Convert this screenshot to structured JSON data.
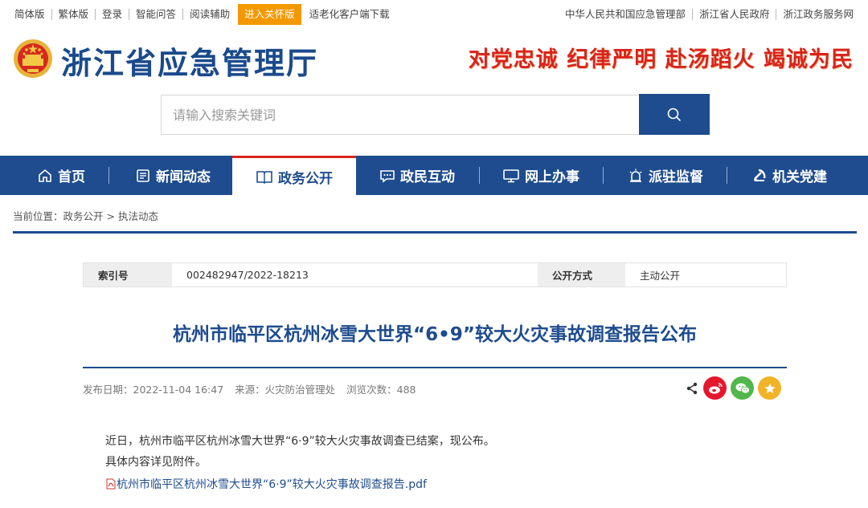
{
  "topbar": {
    "left_links": [
      "简体版",
      "繁体版",
      "登录",
      "智能问答",
      "阅读辅助",
      "进入关怀版",
      "适老化客户端下载"
    ],
    "right_links": [
      "中华人民共和国应急管理部",
      "浙江省人民政府",
      "浙江政务服务网"
    ]
  },
  "header": {
    "site_title": "浙江省应急管理厅",
    "slogan": "对党忠诚 纪律严明 赴汤蹈火 竭诚为民",
    "emblem_icon": "national-emblem-icon"
  },
  "search": {
    "placeholder": "请输入搜索关键词",
    "button_icon": "search-icon"
  },
  "nav": {
    "items": [
      {
        "label": "首页",
        "icon": "home-icon"
      },
      {
        "label": "新闻动态",
        "icon": "newspaper-icon"
      },
      {
        "label": "政务公开",
        "icon": "book-icon"
      },
      {
        "label": "政民互动",
        "icon": "chat-icon"
      },
      {
        "label": "网上办事",
        "icon": "monitor-icon"
      },
      {
        "label": "派驻监督",
        "icon": "alarm-icon"
      },
      {
        "label": "机关党建",
        "icon": "party-icon"
      }
    ],
    "active_index": 2
  },
  "breadcrumb": {
    "prefix": "当前位置：",
    "items": [
      "政务公开",
      "执法动态"
    ],
    "separator": ">"
  },
  "meta": {
    "index_label": "索引号",
    "index_value": "002482947/2022-18213",
    "open_label": "公开方式",
    "open_value": "主动公开"
  },
  "article": {
    "title": "杭州市临平区杭州冰雪大世界“6•9”较大火灾事故调查报告公布",
    "publish_date": "发布日期：2022-11-04 16:47",
    "source": "来源：火灾防治管理处",
    "views": "浏览次数：488",
    "paragraphs": [
      "近日，杭州市临平区杭州冰雪大世界“6·9”较大火灾事故调查已结案，现公布。",
      "具体内容详见附件。"
    ],
    "attachment": "杭州市临平区杭州冰雪大世界“6·9”较大火灾事故调查报告.pdf"
  },
  "share": {
    "icons": [
      "share-icon",
      "weibo-icon",
      "wechat-icon",
      "favorite-icon"
    ]
  },
  "colors": {
    "primary": "#1e4c8e",
    "accent_red": "#d8241b",
    "care_orange": "#f39800",
    "weibo": "#e6162d",
    "wechat": "#51b74a",
    "favorite": "#f3b326"
  }
}
